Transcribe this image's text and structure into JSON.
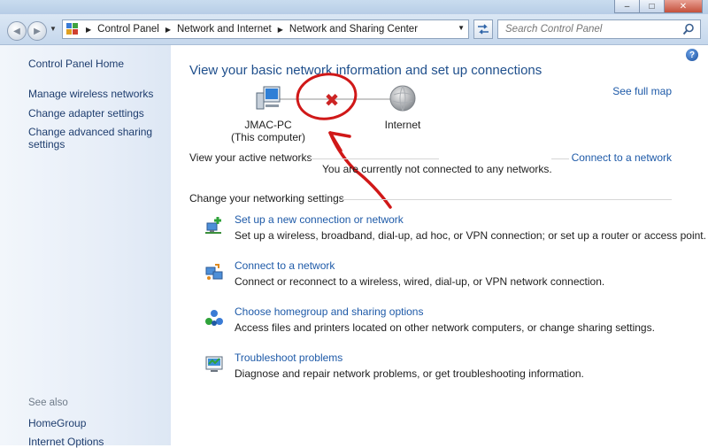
{
  "window": {
    "minimize_label": "–",
    "maximize_label": "□",
    "close_label": "✕"
  },
  "address_bar": {
    "breadcrumbs": [
      "Control Panel",
      "Network and Internet",
      "Network and Sharing Center"
    ],
    "search_placeholder": "Search Control Panel"
  },
  "sidebar": {
    "home": "Control Panel Home",
    "links": [
      "Manage wireless networks",
      "Change adapter settings",
      "Change advanced sharing settings"
    ],
    "see_also_label": "See also",
    "see_also": [
      "HomeGroup",
      "Internet Options"
    ]
  },
  "main": {
    "heading": "View your basic network information and set up connections",
    "see_full_map": "See full map",
    "network_map": {
      "computer_name": "JMAC-PC",
      "computer_caption": "(This computer)",
      "internet_label": "Internet"
    },
    "active_networks_label": "View your active networks",
    "connect_link": "Connect to a network",
    "not_connected_text": "You are currently not connected to any networks.",
    "change_settings_label": "Change your networking settings",
    "tasks": [
      {
        "icon": "new-connection-icon",
        "title": "Set up a new connection or network",
        "desc": "Set up a wireless, broadband, dial-up, ad hoc, or VPN connection; or set up a router or access point."
      },
      {
        "icon": "connect-network-icon",
        "title": "Connect to a network",
        "desc": "Connect or reconnect to a wireless, wired, dial-up, or VPN network connection."
      },
      {
        "icon": "homegroup-icon",
        "title": "Choose homegroup and sharing options",
        "desc": "Access files and printers located on other network computers, or change sharing settings."
      },
      {
        "icon": "troubleshoot-icon",
        "title": "Troubleshoot problems",
        "desc": "Diagnose and repair network problems, or get troubleshooting information."
      }
    ]
  },
  "colors": {
    "link": "#1e5aa8",
    "heading": "#1f4f8c",
    "annotation": "#d01818",
    "error_x": "#cc2424"
  }
}
